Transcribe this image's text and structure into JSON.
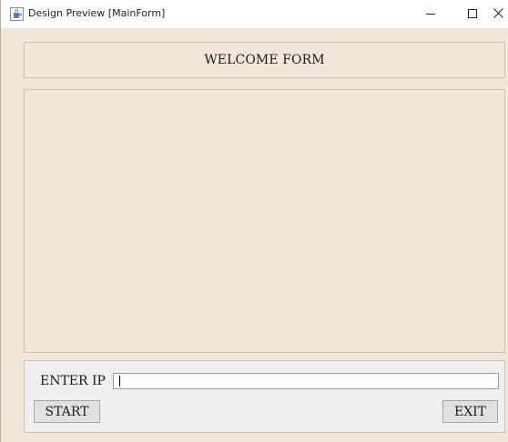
{
  "window": {
    "title": "Design Preview [MainForm]",
    "app_icon": "java-cup-icon",
    "controls": {
      "minimize_icon": "minimize-icon",
      "maximize_icon": "maximize-icon",
      "close_icon": "close-icon"
    }
  },
  "header": {
    "title": "WELCOME FORM"
  },
  "content": {},
  "bottom": {
    "ip_label": "ENTER IP",
    "ip_value": "",
    "ip_placeholder": "",
    "start_label": "START",
    "exit_label": "EXIT"
  },
  "colors": {
    "form_background": "#f3e6db",
    "bottom_panel_background": "#efefef",
    "button_background": "#e1e1e1"
  }
}
